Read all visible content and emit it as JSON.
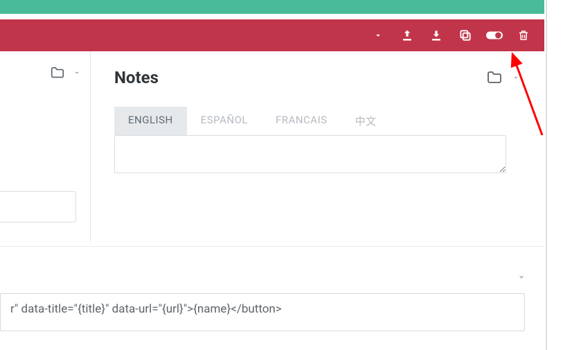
{
  "toolbar": {
    "dropdown": "▾",
    "upload": "upload",
    "download": "download",
    "copy": "copy",
    "toggle": "toggle-on",
    "trash": "trash"
  },
  "main": {
    "title": "Notes",
    "tabs": [
      {
        "label": "ENGLISH",
        "active": true
      },
      {
        "label": "ESPAÑOL",
        "active": false
      },
      {
        "label": "FRANCAIS",
        "active": false
      },
      {
        "label": "中文",
        "active": false
      }
    ],
    "textarea_value": ""
  },
  "bottom": {
    "code_snippet": "r\" data-title=\"{title}\" data-url=\"{url}\">{name}</button>"
  }
}
